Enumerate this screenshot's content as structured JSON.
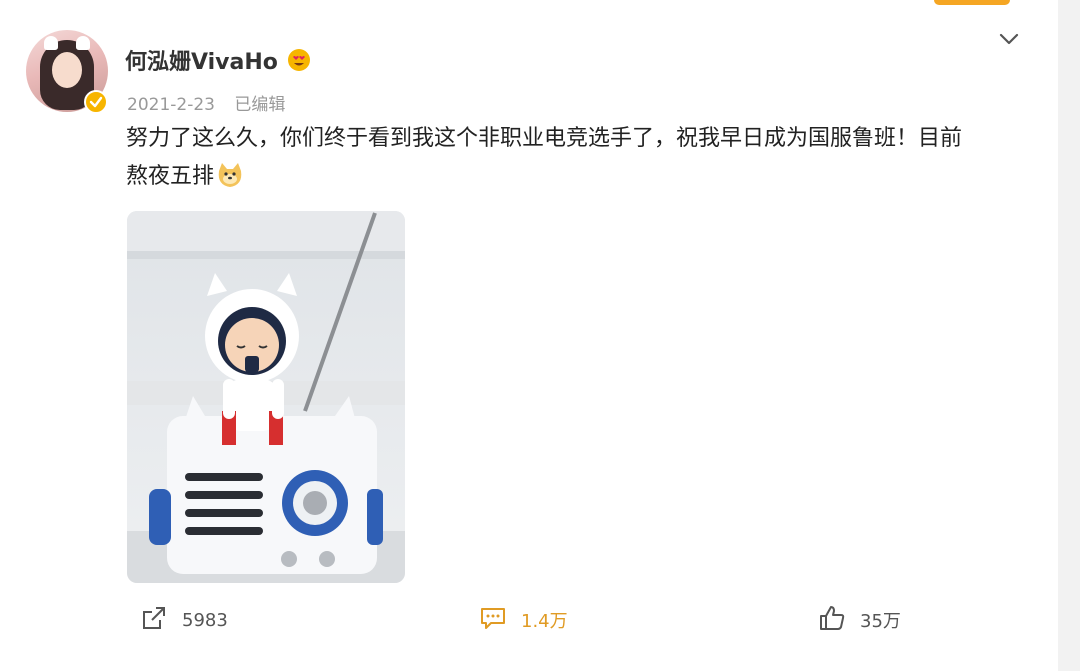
{
  "post": {
    "author": "何泓姗VivaHo",
    "date": "2021-2-23",
    "edited": "已编辑",
    "text_line1": "努力了这么久，你们终于看到我这个非职业电竞选手了，祝我早日成为国服鲁班！目前",
    "text_line2": "熬夜五排"
  },
  "actions": {
    "repost_count": "5983",
    "comment_count": "1.4万",
    "like_count": "35万"
  },
  "colors": {
    "accent": "#e09b24",
    "verified": "#f7b500",
    "text": "#222222",
    "muted": "#999999"
  },
  "icons": {
    "dropdown": "chevron-down-icon",
    "repost": "share-icon",
    "comment": "comment-icon",
    "like": "thumbs-up-icon"
  }
}
